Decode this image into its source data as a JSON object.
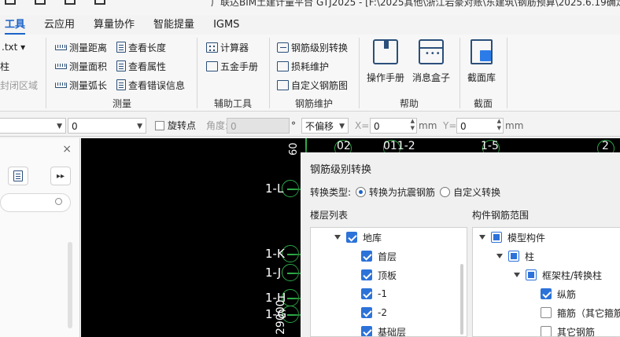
{
  "titlebar": {
    "text": "广联达BIM土建计量平台 GTJ2025 - [F:\\2025其他\\浙江岩豪对账\\东建筑\\钢筋预算\\2025.6.19确定"
  },
  "menu": {
    "tabs": [
      "工具",
      "云应用",
      "算量协作",
      "智能提量",
      "IGMS"
    ],
    "active": "工具"
  },
  "ribbon": {
    "left_clip": [
      ".txt ▾",
      "柱",
      "封闭区域"
    ],
    "measure": {
      "items": [
        "测量距离",
        "测量面积",
        "测量弧长",
        "查看长度",
        "查看属性",
        "查看错误信息"
      ],
      "label": "测量"
    },
    "aux": {
      "items": [
        "计算器",
        "五金手册"
      ],
      "label": "辅助工具"
    },
    "rebar_maint": {
      "items": [
        "钢筋级别转换",
        "损耗维护",
        "自定义钢筋图"
      ],
      "label": "钢筋维护"
    },
    "help": {
      "items": [
        "操作手册",
        "消息盒子"
      ],
      "label": "帮助"
    },
    "section": {
      "items": [
        "截面库"
      ],
      "label": "截面"
    }
  },
  "propbar": {
    "field1_value": "0",
    "rotate_point_label": "旋转点",
    "angle_label": "角度:",
    "angle_value": "0",
    "degree_unit": "°",
    "offset_value": "不偏移",
    "x_label": "X=",
    "x_value": "0",
    "y_label": "Y=",
    "y_value": "0",
    "unit": "mm"
  },
  "leftpanel": {
    "close_glyph": "×",
    "more_glyph": "▸▸"
  },
  "canvas": {
    "labels": [
      "1-L",
      "1-K",
      "1-J",
      "1-H",
      "1-G",
      "29000",
      "02",
      "011-2",
      "1-5",
      "2",
      "60"
    ]
  },
  "dialog": {
    "title": "钢筋级别转换",
    "type_label": "转换类型:",
    "option1": "转换为抗震钢筋",
    "option2": "自定义转换",
    "floor_list_label": "楼层列表",
    "range_label": "构件钢筋范围",
    "floors": [
      "地库",
      "首层",
      "顶板",
      "-1",
      "-2",
      "基础层"
    ],
    "components": [
      "模型构件",
      "柱",
      "框架柱/转换柱",
      "纵筋",
      "箍筋（其它箍筋",
      "其它钢筋"
    ]
  }
}
